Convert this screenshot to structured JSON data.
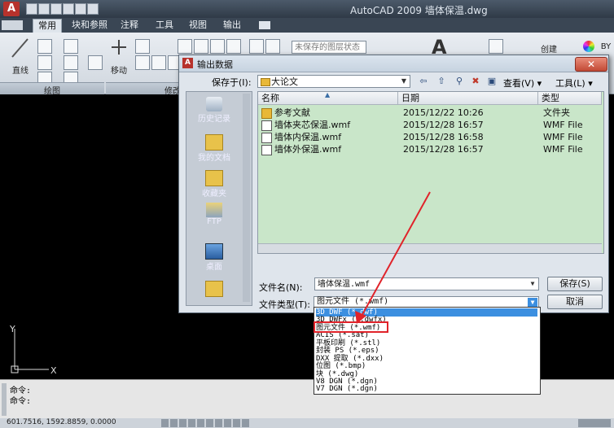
{
  "app": {
    "title": "AutoCAD 2009    墙体保温.dwg",
    "app_button": "A"
  },
  "ribbon": {
    "tabs": [
      "常用",
      "块和参照",
      "注释",
      "工具",
      "视图",
      "输出"
    ],
    "active_tab": "常用",
    "layer_combo": "未保存的图层状态",
    "labels": {
      "line": "直线",
      "move": "移动",
      "create": "创建",
      "bylayer": "BY"
    },
    "panels": {
      "draw": "绘图",
      "modify": "修改"
    }
  },
  "dialog": {
    "title": "输出数据",
    "save_in_label": "保存于(I):",
    "save_in_value": "大论文",
    "view_label": "查看(V)",
    "tools_label": "工具(L)",
    "places": [
      "历史记录",
      "我的文档",
      "收藏夹",
      "FTP",
      "桌面"
    ],
    "columns": [
      "名称",
      "日期",
      "类型"
    ],
    "files": [
      {
        "name": "参考文献",
        "date": "2015/12/22 10:26",
        "type": "文件夹",
        "icon": "folder-icon"
      },
      {
        "name": "墙体夹芯保温.wmf",
        "date": "2015/12/28 16:57",
        "type": "WMF File",
        "icon": "wmf-file-icon"
      },
      {
        "name": "墙体内保温.wmf",
        "date": "2015/12/28 16:58",
        "type": "WMF File",
        "icon": "wmf-file-icon"
      },
      {
        "name": "墙体外保温.wmf",
        "date": "2015/12/28 16:57",
        "type": "WMF File",
        "icon": "wmf-file-icon"
      }
    ],
    "filename_label": "文件名(N):",
    "filename_value": "墙体保温.wmf",
    "filetype_label": "文件类型(T):",
    "filetype_value": "图元文件 (*.wmf)",
    "save_button": "保存(S)",
    "cancel_button": "取消"
  },
  "dropdown": {
    "options": [
      "3D DWF (*.dwf)",
      "3D DWFx (*.dwfx)",
      "图元文件 (*.wmf)",
      "ACIS (*.sat)",
      "平板印刷 (*.stl)",
      "封装 PS (*.eps)",
      "DXX 提取 (*.dxx)",
      "位图 (*.bmp)",
      "块 (*.dwg)",
      "V8 DGN (*.dgn)",
      "V7 DGN (*.dgn)"
    ],
    "highlighted_index": 0,
    "boxed_index": 2
  },
  "ucs": {
    "x": "X",
    "y": "Y"
  },
  "command": {
    "line1": "命令:",
    "line2": "命令:"
  },
  "status": {
    "coords": "601.7516, 1592.8859, 0.0000"
  },
  "colors": {
    "accent_red": "#e0232a",
    "list_bg": "#c9e6c9",
    "selection": "#3c8fe0"
  }
}
